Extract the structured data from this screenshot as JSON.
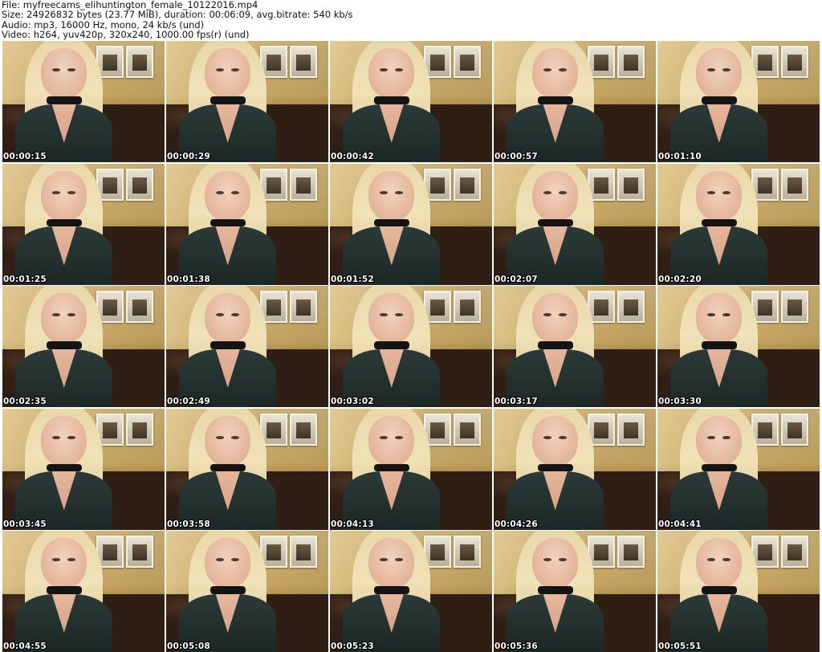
{
  "header": {
    "file_line": "File: myfreecams_elihuntington_female_10122016.mp4",
    "size_line": "Size: 24926832 bytes (23.77 MiB), duration: 00:06:09, avg.bitrate: 540 kb/s",
    "audio_line": "Audio: mp3, 16000 Hz, mono, 24 kb/s (und)",
    "video_line": "Video: h264, yuv420p, 320x240, 1000.00 fps(r) (und)"
  },
  "thumbnails": [
    {
      "timestamp": "00:00:15"
    },
    {
      "timestamp": "00:00:29"
    },
    {
      "timestamp": "00:00:42"
    },
    {
      "timestamp": "00:00:57"
    },
    {
      "timestamp": "00:01:10"
    },
    {
      "timestamp": "00:01:25"
    },
    {
      "timestamp": "00:01:38"
    },
    {
      "timestamp": "00:01:52"
    },
    {
      "timestamp": "00:02:07"
    },
    {
      "timestamp": "00:02:20"
    },
    {
      "timestamp": "00:02:35"
    },
    {
      "timestamp": "00:02:49"
    },
    {
      "timestamp": "00:03:02"
    },
    {
      "timestamp": "00:03:17"
    },
    {
      "timestamp": "00:03:30"
    },
    {
      "timestamp": "00:03:45"
    },
    {
      "timestamp": "00:03:58"
    },
    {
      "timestamp": "00:04:13"
    },
    {
      "timestamp": "00:04:26"
    },
    {
      "timestamp": "00:04:41"
    },
    {
      "timestamp": "00:04:55"
    },
    {
      "timestamp": "00:05:08"
    },
    {
      "timestamp": "00:05:23"
    },
    {
      "timestamp": "00:05:36"
    },
    {
      "timestamp": "00:05:51"
    }
  ]
}
